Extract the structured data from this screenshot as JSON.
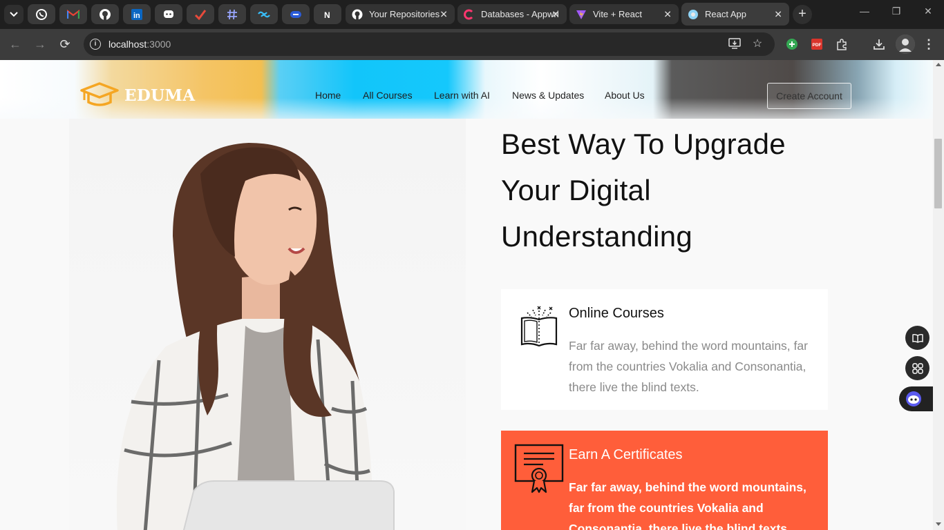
{
  "browser": {
    "tabs": [
      {
        "title": "Your Repositories",
        "icon": "github-icon"
      },
      {
        "title": "Databases - Appwrite",
        "icon": "appwrite-icon"
      },
      {
        "title": "Vite + React",
        "icon": "vite-icon"
      },
      {
        "title": "React App",
        "icon": "react-app-icon",
        "active": true
      }
    ],
    "pinned_tabs": [
      "whatsapp-icon",
      "gmail-icon",
      "github-icon",
      "linkedin-icon",
      "chat-bot-icon",
      "ticktick-icon",
      "hashnode-icon",
      "tailwind-icon",
      "pill-icon",
      "nextjs-icon"
    ],
    "address": {
      "host": "localhost",
      "port": ":3000"
    }
  },
  "site": {
    "brand": "EDUMA",
    "nav": [
      "Home",
      "All Courses",
      "Learn with AI",
      "News & Updates",
      "About Us"
    ],
    "cta": "Create Account"
  },
  "hero": {
    "headline_lines": [
      "Best Way To Upgrade",
      "Your Digital",
      "Understanding"
    ],
    "features": [
      {
        "title": "Online Courses",
        "text": "Far far away, behind the word mountains, far from the countries Vokalia and Consonantia, there live the blind texts.",
        "icon": "open-book-icon"
      },
      {
        "title": "Earn A Certificates",
        "text": "Far far away, behind the word mountains, far from the countries Vokalia and Consonantia, there live the blind texts.",
        "icon": "certificate-icon"
      }
    ]
  },
  "colors": {
    "accent": "#ff5e3a",
    "logo_gold": "#f5a623",
    "chrome_dark": "#1f1f1f"
  }
}
